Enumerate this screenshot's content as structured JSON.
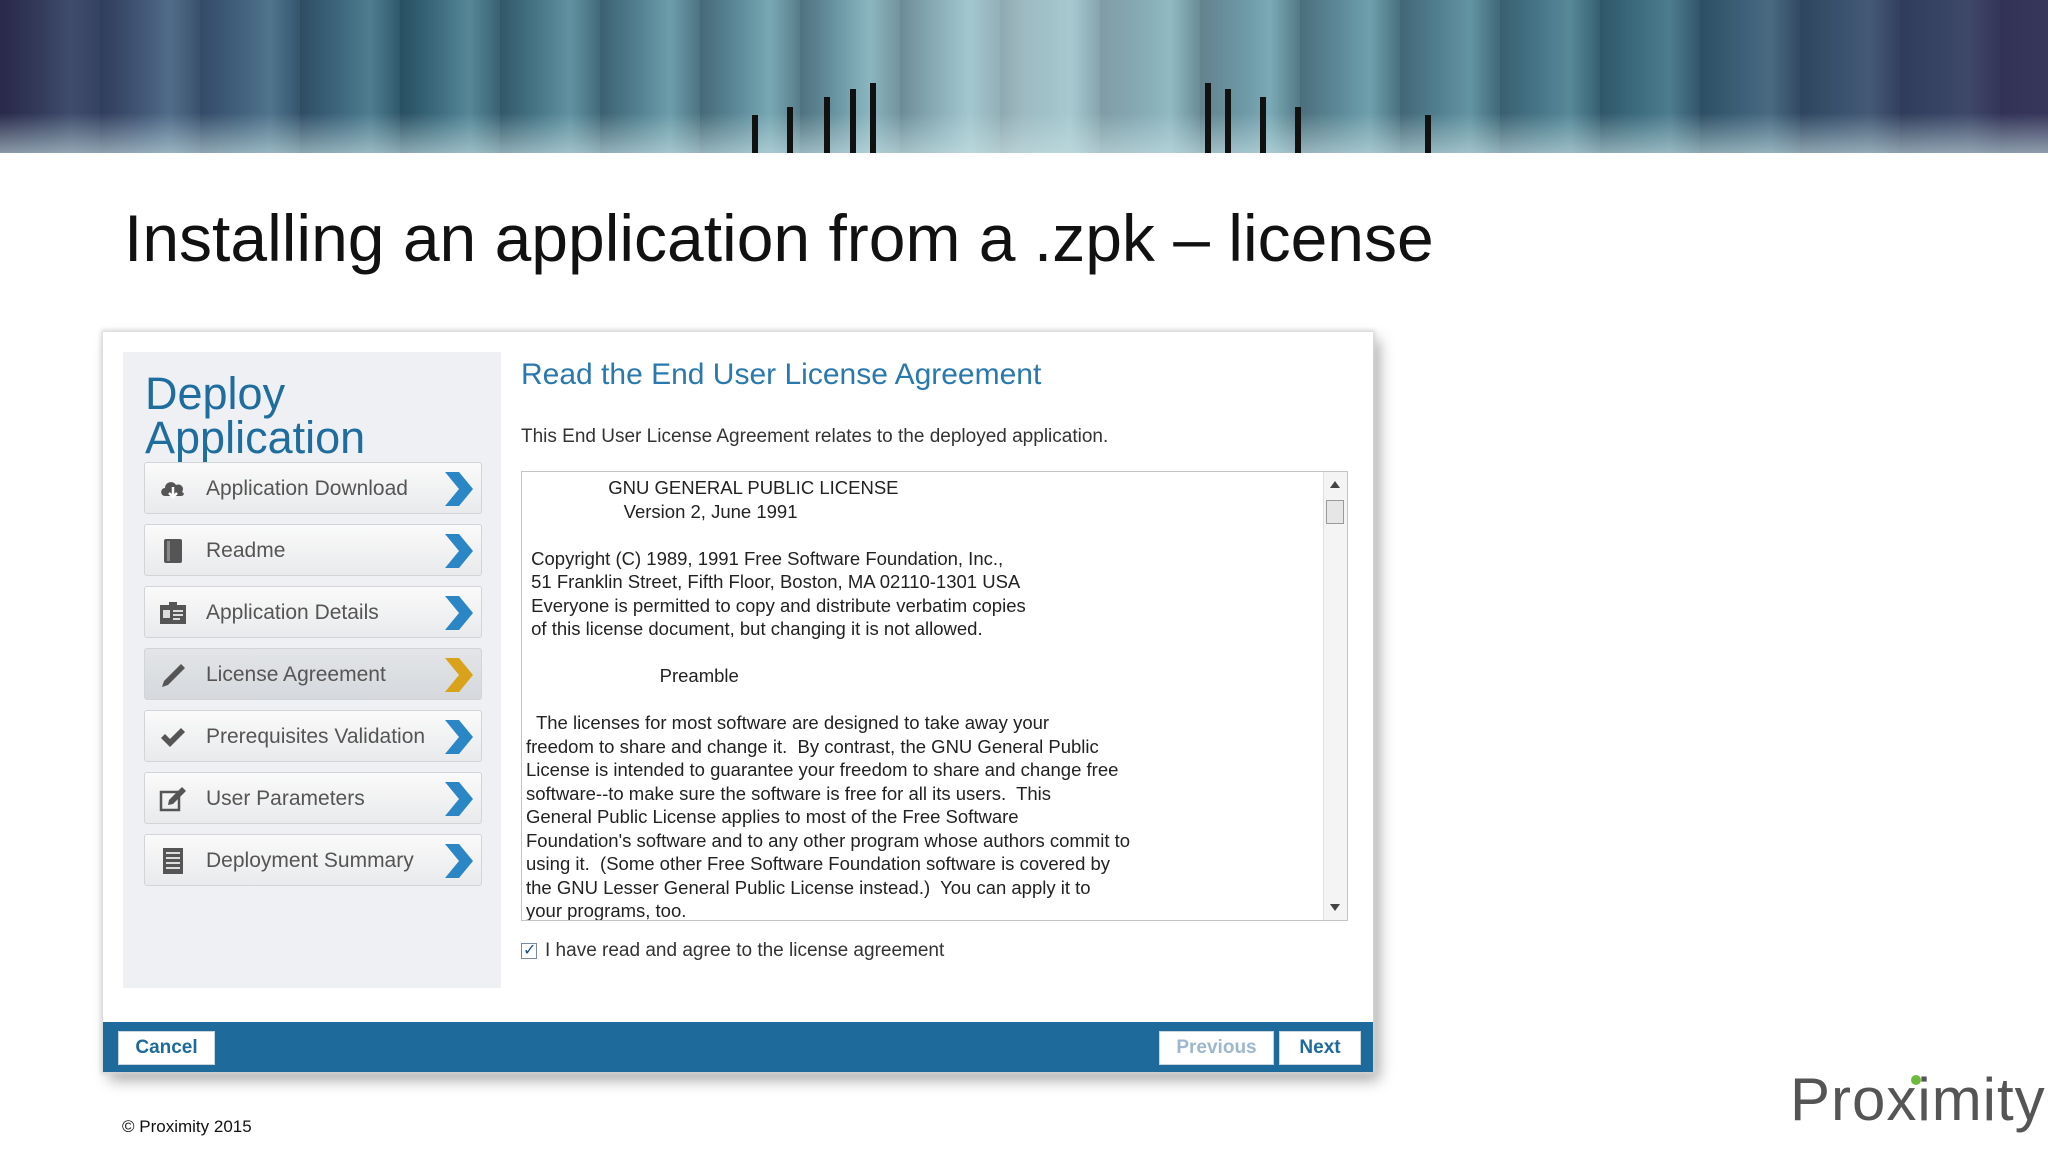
{
  "slide": {
    "title": "Installing an application from a .zpk – license",
    "copyright": "© Proximity 2015",
    "logo_text": "Proximity"
  },
  "dialog": {
    "sidebar": {
      "title": "Deploy Application",
      "steps": [
        {
          "label": "Application Download",
          "icon": "cloud-download-icon",
          "active": false
        },
        {
          "label": "Readme",
          "icon": "book-icon",
          "active": false
        },
        {
          "label": "Application Details",
          "icon": "id-card-icon",
          "active": false
        },
        {
          "label": "License Agreement",
          "icon": "pencil-icon",
          "active": true
        },
        {
          "label": "Prerequisites Validation",
          "icon": "checkmark-icon",
          "active": false
        },
        {
          "label": "User Parameters",
          "icon": "edit-icon",
          "active": false
        },
        {
          "label": "Deployment Summary",
          "icon": "list-icon",
          "active": false
        }
      ]
    },
    "content": {
      "title": "Read the End User License Agreement",
      "description": "This End User License Agreement relates to the deployed application.",
      "license_text": "                GNU GENERAL PUBLIC LICENSE\n                   Version 2, June 1991\n\n Copyright (C) 1989, 1991 Free Software Foundation, Inc.,\n 51 Franklin Street, Fifth Floor, Boston, MA 02110-1301 USA\n Everyone is permitted to copy and distribute verbatim copies\n of this license document, but changing it is not allowed.\n\n                          Preamble\n\n  The licenses for most software are designed to take away your\nfreedom to share and change it.  By contrast, the GNU General Public\nLicense is intended to guarantee your freedom to share and change free\nsoftware--to make sure the software is free for all its users.  This\nGeneral Public License applies to most of the Free Software\nFoundation's software and to any other program whose authors commit to\nusing it.  (Some other Free Software Foundation software is covered by\nthe GNU Lesser General Public License instead.)  You can apply it to\nyour programs, too.",
      "agree_label": "I have read and agree to the license agreement",
      "agree_checked": true
    },
    "footer": {
      "cancel_label": "Cancel",
      "previous_label": "Previous",
      "next_label": "Next"
    },
    "colors": {
      "accent": "#1e6a9a",
      "chevron": "#2a86c4",
      "chevron_active": "#d9a21b"
    }
  }
}
